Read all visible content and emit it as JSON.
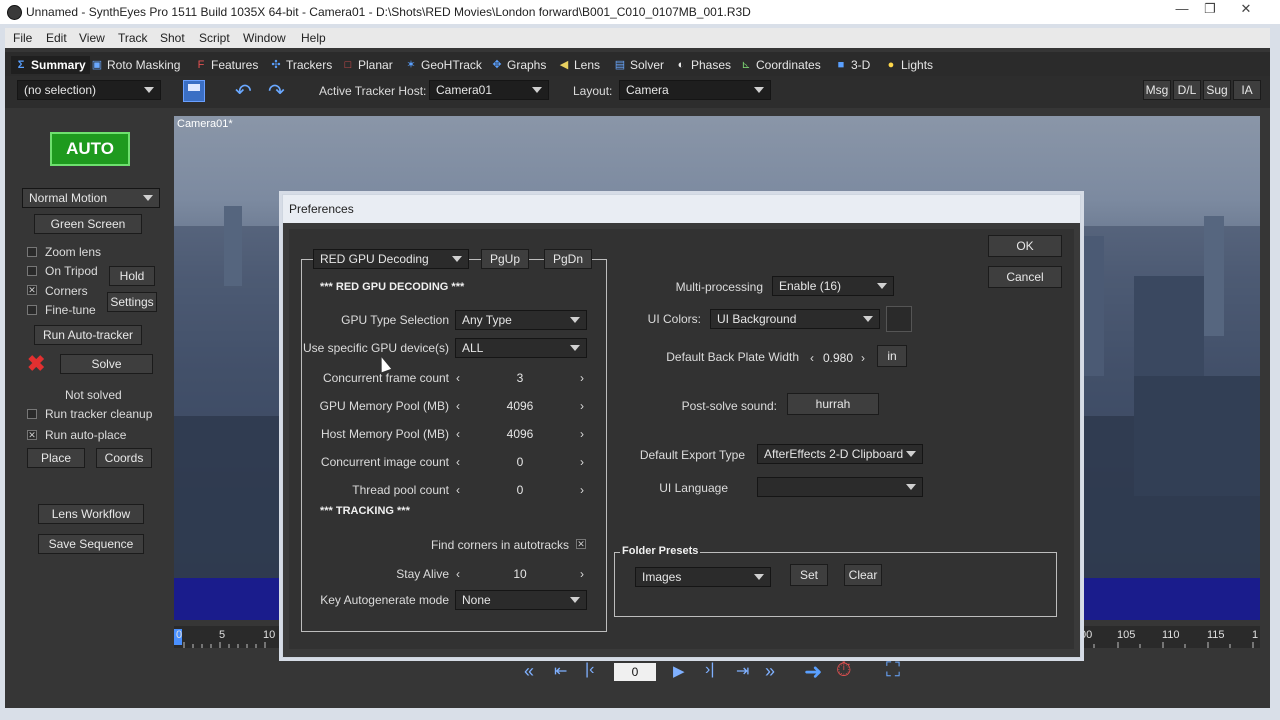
{
  "window": {
    "title": "Unnamed - SynthEyes Pro 1511 Build 1035X 64-bit - Camera01 - D:\\Shots\\RED Movies\\London forward\\B001_C010_0107MB_001.R3D",
    "minimize": "—",
    "maximize": "❐",
    "close": "✕"
  },
  "menu": [
    "File",
    "Edit",
    "View",
    "Track",
    "Shot",
    "Script",
    "Window",
    "Help"
  ],
  "tabs": [
    {
      "label": "Summary",
      "icon": "summary-icon",
      "glyph": "Σ"
    },
    {
      "label": "Roto Masking",
      "icon": "roto-icon",
      "glyph": "▣"
    },
    {
      "label": "Features",
      "icon": "features-icon",
      "glyph": "F"
    },
    {
      "label": "Trackers",
      "icon": "trackers-icon",
      "glyph": "✣"
    },
    {
      "label": "Planar",
      "icon": "planar-icon",
      "glyph": "□"
    },
    {
      "label": "GeoHTrack",
      "icon": "geohtrack-icon",
      "glyph": "✶"
    },
    {
      "label": "Graphs",
      "icon": "graphs-icon",
      "glyph": "✥"
    },
    {
      "label": "Lens",
      "icon": "lens-icon",
      "glyph": "◀"
    },
    {
      "label": "Solver",
      "icon": "solver-icon",
      "glyph": "▤"
    },
    {
      "label": "Phases",
      "icon": "phases-icon",
      "glyph": "◐"
    },
    {
      "label": "Coordinates",
      "icon": "coordinates-icon",
      "glyph": "⊾"
    },
    {
      "label": "3-D",
      "icon": "cube-icon",
      "glyph": "■"
    },
    {
      "label": "Lights",
      "icon": "lightbulb-icon",
      "glyph": "💡"
    }
  ],
  "toolbar": {
    "selection": "(no selection)",
    "active_tracker_host_label": "Active Tracker Host:",
    "active_tracker_host": "Camera01",
    "layout_label": "Layout:",
    "layout": "Camera",
    "right_buttons": [
      "Msg",
      "D/L",
      "Sug",
      "IA"
    ]
  },
  "left": {
    "auto": "AUTO",
    "motion": "Normal Motion",
    "green_screen": "Green Screen",
    "zoom_lens": "Zoom lens",
    "on_tripod": "On Tripod",
    "hold": "Hold",
    "corners": "Corners",
    "settings": "Settings",
    "fine_tune": "Fine-tune",
    "run_auto_tracker": "Run Auto-tracker",
    "solve": "Solve",
    "status": "Not solved",
    "run_tracker_cleanup": "Run tracker cleanup",
    "run_auto_place": "Run auto-place",
    "place": "Place",
    "coords": "Coords",
    "lens_workflow": "Lens Workflow",
    "save_sequence": "Save Sequence"
  },
  "viewport": {
    "label": "Camera01*"
  },
  "timeline": {
    "ticks_left": [
      "0",
      "5",
      "10"
    ],
    "ticks_right": [
      "00",
      "105",
      "110",
      "115",
      "1"
    ]
  },
  "playback": {
    "frame": "0"
  },
  "dialog": {
    "title": "Preferences",
    "section_select": "RED GPU Decoding",
    "pgup": "PgUp",
    "pgdn": "PgDn",
    "hdr_red": "*** RED GPU DECODING ***",
    "gpu_type_label": "GPU Type Selection",
    "gpu_type": "Any Type",
    "gpu_device_label": "Use specific GPU device(s)",
    "gpu_device": "ALL",
    "concurrent_frame_label": "Concurrent frame count",
    "concurrent_frame": "3",
    "gpu_mem_label": "GPU Memory Pool (MB)",
    "gpu_mem": "4096",
    "host_mem_label": "Host Memory Pool (MB)",
    "host_mem": "4096",
    "concurrent_image_label": "Concurrent image count",
    "concurrent_image": "0",
    "thread_pool_label": "Thread pool count",
    "thread_pool": "0",
    "hdr_tracking": "*** TRACKING ***",
    "find_corners_label": "Find corners in autotracks",
    "stay_alive_label": "Stay Alive",
    "stay_alive": "10",
    "key_autogen_label": "Key Autogenerate mode",
    "key_autogen": "None",
    "multiprocessing_label": "Multi-processing",
    "multiprocessing": "Enable (16)",
    "ui_colors_label": "UI Colors:",
    "ui_colors": "UI Background",
    "back_plate_label": "Default Back Plate Width",
    "back_plate": "0.980",
    "back_plate_unit": "in",
    "post_solve_label": "Post-solve sound:",
    "post_solve": "hurrah",
    "export_type_label": "Default Export Type",
    "export_type": "AfterEffects 2-D Clipboard",
    "ui_language_label": "UI Language",
    "ui_language": "",
    "folder_presets_label": "Folder Presets",
    "folder_preset": "Images",
    "set": "Set",
    "clear": "Clear",
    "ok": "OK",
    "cancel": "Cancel"
  }
}
